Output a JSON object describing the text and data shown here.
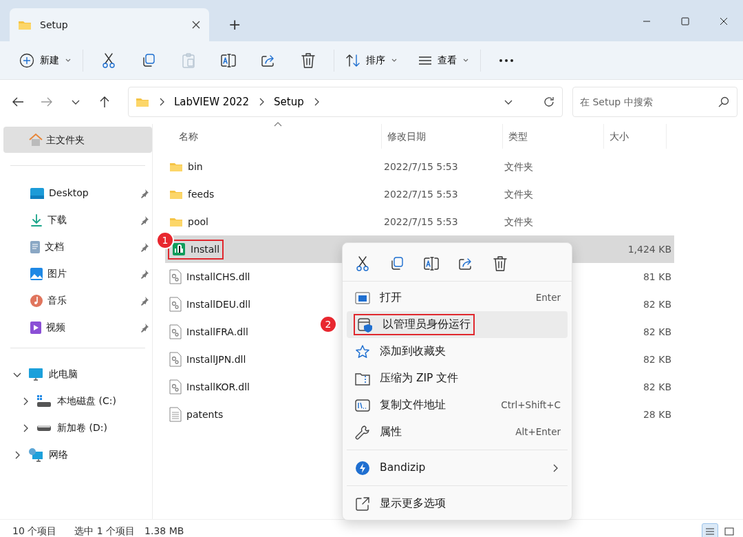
{
  "window": {
    "tab_title": "Setup",
    "new_tab": "+"
  },
  "toolbar": {
    "new_label": "新建",
    "paste_disabled": true,
    "sort_label": "排序",
    "view_label": "查看"
  },
  "address": {
    "crumbs": [
      "LabVIEW 2022",
      "Setup"
    ],
    "search_placeholder": "在 Setup 中搜索"
  },
  "sidebar": {
    "home": {
      "label": "主文件夹",
      "selected": true
    },
    "quick_access": [
      {
        "label": "Desktop",
        "kind": "desktop",
        "pinned": true
      },
      {
        "label": "下载",
        "kind": "download",
        "pinned": true
      },
      {
        "label": "文档",
        "kind": "document",
        "pinned": true
      },
      {
        "label": "图片",
        "kind": "picture",
        "pinned": true
      },
      {
        "label": "音乐",
        "kind": "music",
        "pinned": true
      },
      {
        "label": "视频",
        "kind": "video",
        "pinned": true
      }
    ],
    "tree": [
      {
        "label": "此电脑",
        "kind": "pc",
        "expanded": true,
        "children": [
          {
            "label": "本地磁盘 (C:)",
            "kind": "sysdrive",
            "expanded": false
          },
          {
            "label": "新加卷 (D:)",
            "kind": "drive",
            "expanded": false
          }
        ]
      },
      {
        "label": "网络",
        "kind": "network",
        "expanded": false
      }
    ]
  },
  "table": {
    "columns": [
      "名称",
      "修改日期",
      "类型",
      "大小"
    ],
    "rows": [
      {
        "name": "bin",
        "kind": "folder",
        "date": "2022/7/15 5:53",
        "type": "文件夹",
        "selected": false
      },
      {
        "name": "feeds",
        "kind": "folder",
        "date": "2022/7/15 5:53",
        "type": "文件夹",
        "selected": false
      },
      {
        "name": "pool",
        "kind": "folder",
        "date": "2022/7/15 5:53",
        "type": "文件夹",
        "selected": false
      },
      {
        "name": "Install",
        "kind": "app",
        "size": "1,424 KB",
        "selected": true,
        "outlined": true,
        "badge": "1"
      },
      {
        "name": "InstallCHS.dll",
        "kind": "dll",
        "size": "81 KB",
        "selected": false
      },
      {
        "name": "InstallDEU.dll",
        "kind": "dll",
        "size": "82 KB",
        "selected": false
      },
      {
        "name": "InstallFRA.dll",
        "kind": "dll",
        "size": "82 KB",
        "selected": false
      },
      {
        "name": "InstallJPN.dll",
        "kind": "dll",
        "size": "82 KB",
        "selected": false
      },
      {
        "name": "InstallKOR.dll",
        "kind": "dll",
        "size": "82 KB",
        "selected": false
      },
      {
        "name": "patents",
        "kind": "text",
        "size": "28 KB",
        "selected": false
      }
    ]
  },
  "context_menu": {
    "items": [
      {
        "label": "打开",
        "kind": "open",
        "shortcut": "Enter",
        "selected": false
      },
      {
        "label": "以管理员身份运行",
        "kind": "admin",
        "selected": true,
        "outlined": true,
        "badge": "2"
      },
      {
        "label": "添加到收藏夹",
        "kind": "star",
        "selected": false
      },
      {
        "label": "压缩为 ZIP 文件",
        "kind": "zip",
        "selected": false
      },
      {
        "label": "复制文件地址",
        "kind": "path",
        "shortcut": "Ctrl+Shift+C",
        "selected": false
      },
      {
        "label": "属性",
        "kind": "wrench",
        "shortcut": "Alt+Enter",
        "selected": false
      },
      {
        "label": "Bandizip",
        "kind": "bandizip",
        "submenu": true,
        "selected": false,
        "group_start": true
      },
      {
        "label": "显示更多选项",
        "kind": "more",
        "selected": false,
        "group_start": true
      }
    ]
  },
  "status_bar": {
    "count": "10 个项目",
    "selection": "选中 1 个项目",
    "size": "1.38 MB",
    "views": [
      {
        "selected": true
      },
      {
        "selected": false
      }
    ]
  }
}
